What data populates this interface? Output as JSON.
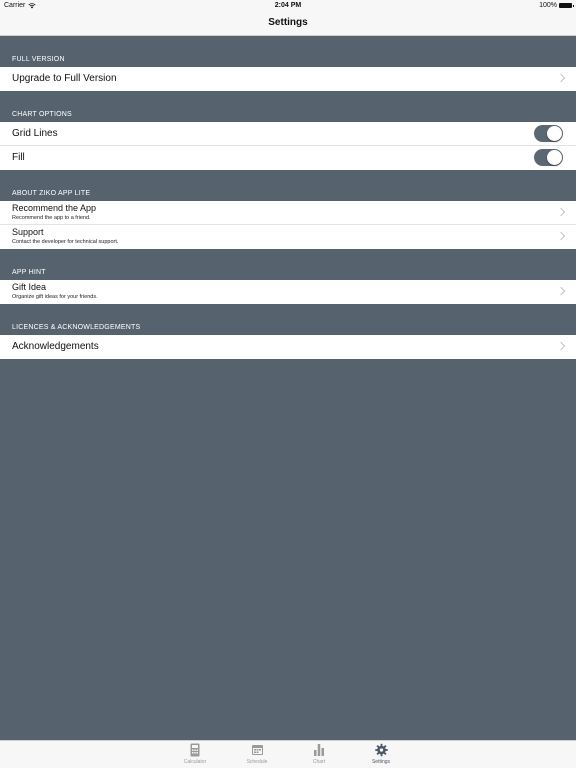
{
  "status_bar": {
    "carrier": "Carrier",
    "time": "2:04 PM",
    "battery": "100%"
  },
  "nav": {
    "title": "Settings"
  },
  "sections": {
    "full_version": {
      "header": "FULL VERSION",
      "upgrade_label": "Upgrade to Full Version"
    },
    "chart_options": {
      "header": "CHART OPTIONS",
      "grid_lines_label": "Grid Lines",
      "grid_lines_on": true,
      "fill_label": "Fill",
      "fill_on": true
    },
    "about": {
      "header": "ABOUT ZIKO APP LITE",
      "recommend_label": "Recommend the App",
      "recommend_sub": "Recommend the app to a friend.",
      "support_label": "Support",
      "support_sub": "Contact the developer for technical support."
    },
    "app_hint": {
      "header": "APP HINT",
      "gift_label": "Gift Idea",
      "gift_sub": "Organize gift ideas for your friends."
    },
    "licences": {
      "header": "LICENCES & ACKNOWLEDGEMENTS",
      "ack_label": "Acknowledgements"
    }
  },
  "tabbar": {
    "tabs": [
      {
        "label": "Calculator",
        "icon": "calculator-icon"
      },
      {
        "label": "Schedule",
        "icon": "calendar-icon"
      },
      {
        "label": "Chart",
        "icon": "bar-chart-icon"
      },
      {
        "label": "Settings",
        "icon": "gear-icon"
      }
    ],
    "active_tab": "Settings"
  },
  "colors": {
    "background": "#56636f",
    "toggle_on": "#5b6772",
    "tab_active": "#4d5a66"
  }
}
